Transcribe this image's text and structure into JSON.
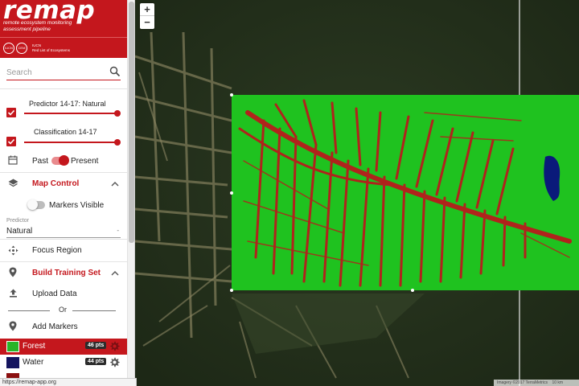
{
  "app": {
    "title": "remap",
    "subtitle_line1": "remote ecosystem monitoring",
    "subtitle_line2": "assessment pipeline",
    "partner_text_line1": "IUCN",
    "partner_text_line2": "Red List of Ecosystems",
    "partner_logo_text": "CEM"
  },
  "search": {
    "placeholder": "Search",
    "value": ""
  },
  "layers": [
    {
      "label": "Predictor 14-17: Natural",
      "checked": true
    },
    {
      "label": "Classification 14-17",
      "checked": true
    }
  ],
  "time_toggle": {
    "left_label": "Past",
    "right_label": "Present",
    "state": "Present"
  },
  "map_control": {
    "label": "Map Control",
    "markers_label": "Markers Visible",
    "markers_on": false
  },
  "predictor": {
    "label": "Predictor",
    "value": "Natural"
  },
  "focus_region": {
    "label": "Focus Region"
  },
  "training": {
    "label": "Build Training Set",
    "upload_label": "Upload Data",
    "or_label": "Or",
    "add_markers_label": "Add Markers"
  },
  "classes": [
    {
      "name": "Forest",
      "points": "46 pts",
      "color": "#29b529",
      "selected": true
    },
    {
      "name": "Water",
      "points": "44 pts",
      "color": "#14145e",
      "selected": false
    },
    {
      "name": "",
      "points": "",
      "color": "#8b1010",
      "selected": false
    }
  ],
  "map": {
    "zoom_in": "+",
    "zoom_out": "−",
    "attribution": "Imagery ©2017 TerraMetrics",
    "scale": "10 km"
  },
  "status_bar": {
    "url": "https://remap-app.org"
  },
  "colors": {
    "brand_red": "#c4171d",
    "forest_green": "#1fc21f",
    "deforested_red": "#b0231c",
    "water_blue": "#0a1a7a"
  }
}
